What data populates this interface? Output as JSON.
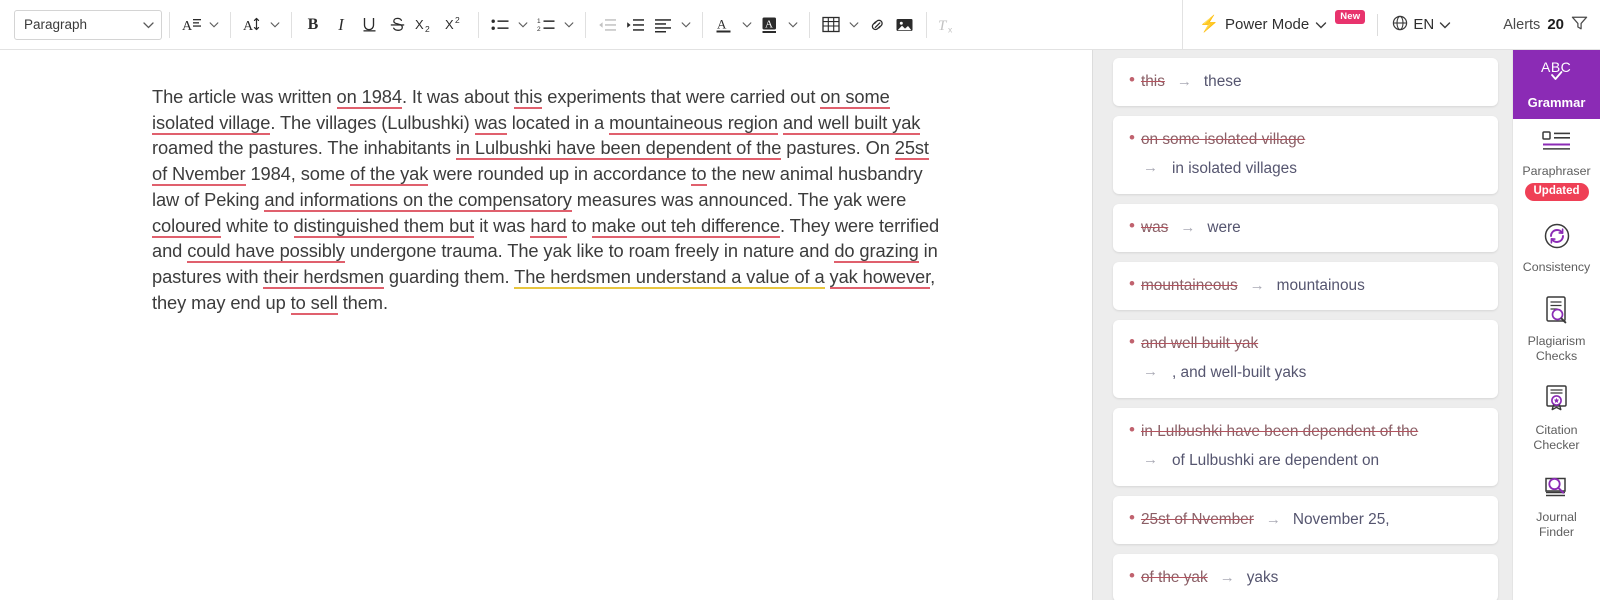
{
  "toolbar": {
    "paragraph_label": "Paragraph",
    "font_family_icon": "font-family-icon",
    "font_size_icon": "font-size-icon",
    "bold_label": "B",
    "italic_label": "I",
    "underline_label": "U",
    "strikethrough_label": "S",
    "subscript_label": "X",
    "subscript_sub": "2",
    "superscript_label": "X",
    "superscript_sup": "2",
    "bullet_list": "bulleted-list-icon",
    "numbered_list": "numbered-list-icon",
    "outdent": "outdent-icon",
    "indent": "indent-icon",
    "align": "align-icon",
    "text_color": "A",
    "highlight_color": "A",
    "table": "table-icon",
    "link": "link-icon",
    "image": "image-icon",
    "clear_format": "clear-formatting-icon"
  },
  "header": {
    "power_mode_label": "Power Mode",
    "power_mode_badge": "New",
    "language_label": "EN",
    "alerts_label": "Alerts",
    "alerts_count": "20",
    "filter_icon": "filter-icon"
  },
  "document": {
    "lines": [
      "The article was written on 1984. It was about this experiments that were carried out on some isolated village. The villages (Lulbushki) was located in a mountaineous region and well built yak roamed the pastures. The inhabitants in Lulbushki have been dependent of the pastures. On 25st of Nvember 1984, some of the yak were rounded up in accordance to the new animal husbandry law of Peking and informations on the compensatory measures was announced. The yak were coloured white to distinguished them but it was hard to make out teh difference. They were terrified and could have possibly undergone trauma. The yak like to roam freely in nature and do grazing in pastures with their herdsmen guarding them. The herdsmen understand a value of a yak however, they may end up to sell them."
    ],
    "segments": [
      {
        "t": "The article was written ",
        "m": "none"
      },
      {
        "t": "on 1984",
        "m": "err"
      },
      {
        "t": ". It was about ",
        "m": "none"
      },
      {
        "t": "this",
        "m": "err"
      },
      {
        "t": " experiments that were carried out ",
        "m": "none"
      },
      {
        "t": "on some isolated village",
        "m": "err"
      },
      {
        "t": ". The villages (Lulbushki) ",
        "m": "none"
      },
      {
        "t": "was",
        "m": "err"
      },
      {
        "t": " located in a ",
        "m": "none"
      },
      {
        "t": "mountaineous region",
        "m": "err"
      },
      {
        "t": " ",
        "m": "none"
      },
      {
        "t": "and well built yak",
        "m": "err"
      },
      {
        "t": " roamed the pastures. The inhabitants ",
        "m": "none"
      },
      {
        "t": "in Lulbushki have been dependent of the",
        "m": "err"
      },
      {
        "t": " pastures. On ",
        "m": "none"
      },
      {
        "t": "25st of Nvember",
        "m": "err"
      },
      {
        "t": " 1984, some ",
        "m": "none"
      },
      {
        "t": "of the yak",
        "m": "err"
      },
      {
        "t": " were rounded up in accordance ",
        "m": "none"
      },
      {
        "t": "to",
        "m": "err"
      },
      {
        "t": " the new animal husbandry law of Peking ",
        "m": "none"
      },
      {
        "t": "and informations on the compensatory",
        "m": "err"
      },
      {
        "t": " measures was announced. The yak were ",
        "m": "none"
      },
      {
        "t": "coloured",
        "m": "err"
      },
      {
        "t": " white to ",
        "m": "none"
      },
      {
        "t": "distinguished them but",
        "m": "err"
      },
      {
        "t": " it was ",
        "m": "none"
      },
      {
        "t": "hard",
        "m": "err"
      },
      {
        "t": " to ",
        "m": "none"
      },
      {
        "t": "make out teh difference",
        "m": "err"
      },
      {
        "t": ". They were terrified and ",
        "m": "none"
      },
      {
        "t": "could have possibly",
        "m": "err"
      },
      {
        "t": " undergone trauma. The yak like to roam freely in nature and ",
        "m": "none"
      },
      {
        "t": "do grazing",
        "m": "err"
      },
      {
        "t": " in pastures with ",
        "m": "none"
      },
      {
        "t": "their herdsmen",
        "m": "err"
      },
      {
        "t": " guarding them. ",
        "m": "none"
      },
      {
        "t": "The herdsmen understand a value of a",
        "m": "warn"
      },
      {
        "t": " ",
        "m": "none"
      },
      {
        "t": "yak however",
        "m": "err"
      },
      {
        "t": ", they may end up ",
        "m": "none"
      },
      {
        "t": "to sell",
        "m": "err"
      },
      {
        "t": " them.",
        "m": "none"
      }
    ]
  },
  "suggestions": [
    {
      "original": "this",
      "suggestion": "these",
      "stacked": false
    },
    {
      "original": "on some isolated village",
      "suggestion": "in isolated villages",
      "stacked": true
    },
    {
      "original": "was",
      "suggestion": "were",
      "stacked": false
    },
    {
      "original": "mountaineous",
      "suggestion": "mountainous",
      "stacked": false
    },
    {
      "original": "and well built yak",
      "suggestion": ", and well-built yaks",
      "stacked": true
    },
    {
      "original": "in Lulbushki have been dependent of the",
      "suggestion": "of Lulbushki are dependent on",
      "stacked": true
    },
    {
      "original": "25st of Nvember",
      "suggestion": "November 25,",
      "stacked": false
    },
    {
      "original": "of the yak",
      "suggestion": "yaks",
      "stacked": false
    }
  ],
  "rail": {
    "items": [
      {
        "label": "Grammar",
        "icon": "abc-check-icon",
        "active": true,
        "badge": ""
      },
      {
        "label": "Paraphraser",
        "icon": "paraphraser-icon",
        "active": false,
        "badge": "Updated"
      },
      {
        "label": "Consistency",
        "icon": "consistency-refresh-icon",
        "active": false,
        "badge": ""
      },
      {
        "label": "Plagiarism Checks",
        "icon": "plagiarism-doc-search-icon",
        "active": false,
        "badge": ""
      },
      {
        "label": "Citation Checker",
        "icon": "citation-certificate-icon",
        "active": false,
        "badge": ""
      },
      {
        "label": "Journal Finder",
        "icon": "journal-search-icon",
        "active": false,
        "badge": ""
      }
    ]
  },
  "colors": {
    "accent_purple": "#8b2bb5",
    "badge_new": "#e8336d",
    "badge_updated": "#ef4056",
    "grammar_underline": "#e0606d",
    "style_underline": "#e8c63f",
    "panel_bg": "#ededed"
  }
}
